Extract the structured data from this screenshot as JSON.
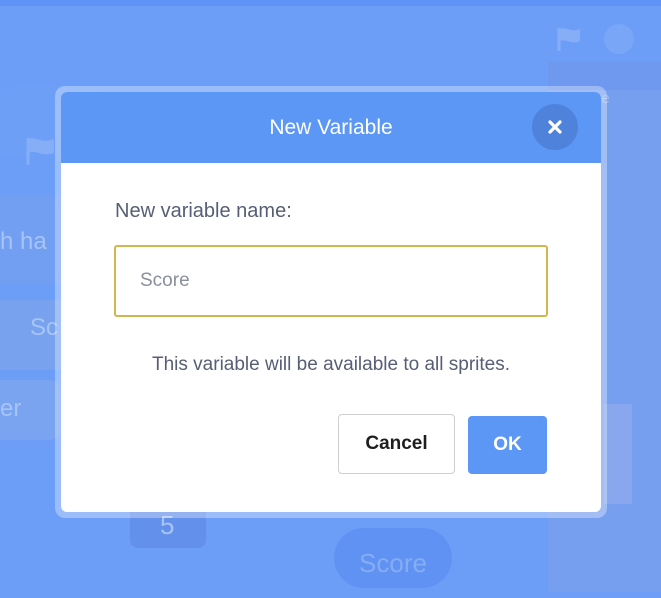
{
  "background": {
    "stage_score_hint": "ore",
    "block_texts": [
      "h ha",
      "Sc",
      "er",
      "5"
    ],
    "score_pill_label": "Score"
  },
  "dialog": {
    "title": "New Variable",
    "field_label": "New variable name:",
    "input_value": "Score",
    "info_text": "This variable will be available to all sprites.",
    "cancel_label": "Cancel",
    "ok_label": "OK"
  },
  "icons": {
    "close": "close-icon",
    "flag": "green-flag-icon",
    "stop": "stop-icon"
  },
  "colors": {
    "header": "#5c97f6",
    "close_bg": "#4f82db",
    "ok_bg": "#5c97f6",
    "input_focus_border": "#d4b64f",
    "backdrop": "#6c9ef8"
  }
}
